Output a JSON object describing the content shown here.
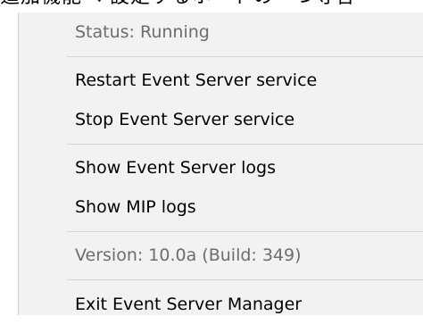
{
  "top_strip": {
    "text": "追加機能へ 設定するホードの一つ寺各"
  },
  "context_menu": {
    "status": "Status: Running",
    "restart": "Restart Event Server service",
    "stop": "Stop Event Server service",
    "show_event_logs": "Show Event Server logs",
    "show_mip_logs": "Show MIP logs",
    "version": "Version: 10.0a (Build: 349)",
    "exit": "Exit Event Server Manager"
  }
}
